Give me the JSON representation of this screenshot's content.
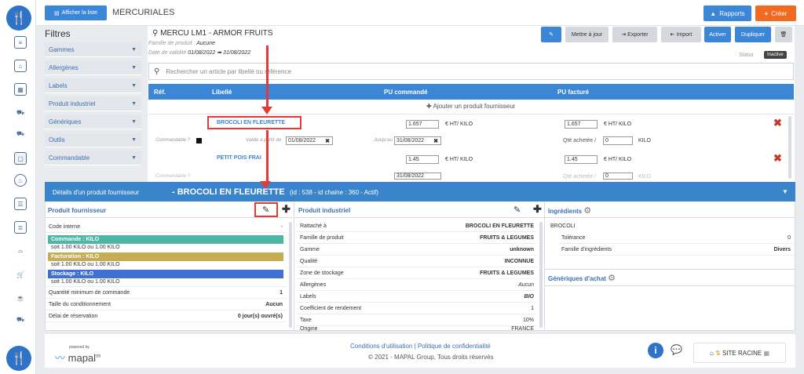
{
  "topbar": {
    "toggle_list": "Afficher la liste",
    "title": "MERCURIALES",
    "rapports": "Rapports",
    "creer": "Créer"
  },
  "filters": {
    "title": "Filtres",
    "items": [
      "Gammes",
      "Allergènes",
      "Labels",
      "Produit industriel",
      "Génériques",
      "Outils",
      "Commandable"
    ]
  },
  "header": {
    "mercu": "MERCU LM1 - ARMOR FRUITS",
    "famille_label": "Famille de produit",
    "famille_value": "Aucune",
    "validite_label": "Date de validité",
    "date_from": "01/08/2022",
    "date_to": "31/08/2022",
    "statut_label": "Statut",
    "statut_value": "Inactive"
  },
  "toolbar": {
    "mettre_a_jour": "Mettre à jour",
    "exporter": "Exporter",
    "importer": "Import",
    "activer": "Activer",
    "dupliquer": "Dupliquer"
  },
  "search": {
    "placeholder": "Rechercher un article par libellé ou référence"
  },
  "table": {
    "headers": [
      "Réf.",
      "Libellé",
      "PU commandé",
      "PU facturé"
    ],
    "add_label": "Ajouter un produit fournisseur",
    "rows": [
      {
        "libelle": "BROCOLI EN FLEURETTE",
        "pu_cmd": "1.657",
        "pu_fact": "1.657",
        "unit": "€ HT/ KILO",
        "commandable": "Commandable ?",
        "valide_label": "Valide à partir du",
        "valide": "01/08/2022",
        "jusqu_label": "Jusqu'au",
        "jusqu": "31/08/2022",
        "qte_label": "Qté achetée /",
        "qte": "0",
        "qte_unit": "KILO"
      },
      {
        "libelle": "PETIT POIS FRAI",
        "pu_cmd": "1.45",
        "pu_fact": "1.45",
        "unit": "€ HT/ KILO",
        "commandable": "Commandable ?",
        "jusqu": "31/08/2022",
        "qte_label": "Qté achetée /",
        "qte": "0",
        "qte_unit": "KILO"
      }
    ]
  },
  "details": {
    "title": "Détails d'un produit fournisseur",
    "product": "- BROCOLI EN FLEURETTE",
    "meta": "(id : 538 - id chaine : 360 - Actif)",
    "pf": {
      "title": "Produit fournisseur",
      "code_label": "Code interne",
      "code_value": "-",
      "commande": "Commande : KILO",
      "commande_sub": "soit 1.00 KILO ou 1.00 KILO",
      "facturation": "Facturation : KILO",
      "facturation_sub": "soit 1.00 KILO ou 1.00 KILO",
      "stockage": "Stockage : KILO",
      "stockage_sub": "soit 1.00 KILO ou 1.00 KILO",
      "rows": [
        [
          "Quantité minimum de commande",
          "1"
        ],
        [
          "Taille du conditionnement",
          "Aucun"
        ],
        [
          "Délai de réservation",
          "0 jour(s) ouvré(s)"
        ]
      ]
    },
    "pi": {
      "title": "Produit industriel",
      "rows": [
        [
          "Rattaché à",
          "BROCOLI EN FLEURETTE"
        ],
        [
          "Famille de produit",
          "FRUITS & LEGUMES"
        ],
        [
          "Gamme",
          "unknown"
        ],
        [
          "Qualité",
          "INCONNUE"
        ],
        [
          "Zone de stockage",
          "FRUITS & LEGUMES"
        ],
        [
          "Allergènes",
          "Aucun"
        ],
        [
          "Labels",
          "BIO"
        ],
        [
          "Coefficient de rendement",
          "1"
        ],
        [
          "Taxe",
          "10%"
        ],
        [
          "Origine",
          "FRANCE"
        ]
      ]
    },
    "ing": {
      "title": "Ingrédients",
      "name": "BROCOLI",
      "rows": [
        [
          "Tolérance",
          "0"
        ],
        [
          "Famille d'ingrédients",
          "Divers"
        ]
      ],
      "generiques": "Génériques d'achat"
    }
  },
  "footer": {
    "powered": "powered by",
    "brand": "mapal",
    "brand_sup": "os",
    "cgu": "Conditions d'utilisation",
    "sep": "|",
    "privacy": "Politique de confidentialité",
    "copy": "© 2021 - MAPAL Group, Tous droits réservés",
    "site": "SITE RACINE"
  },
  "colors": {
    "accent": "#3b86d6",
    "danger": "#e53935",
    "orange": "#f06a22"
  }
}
